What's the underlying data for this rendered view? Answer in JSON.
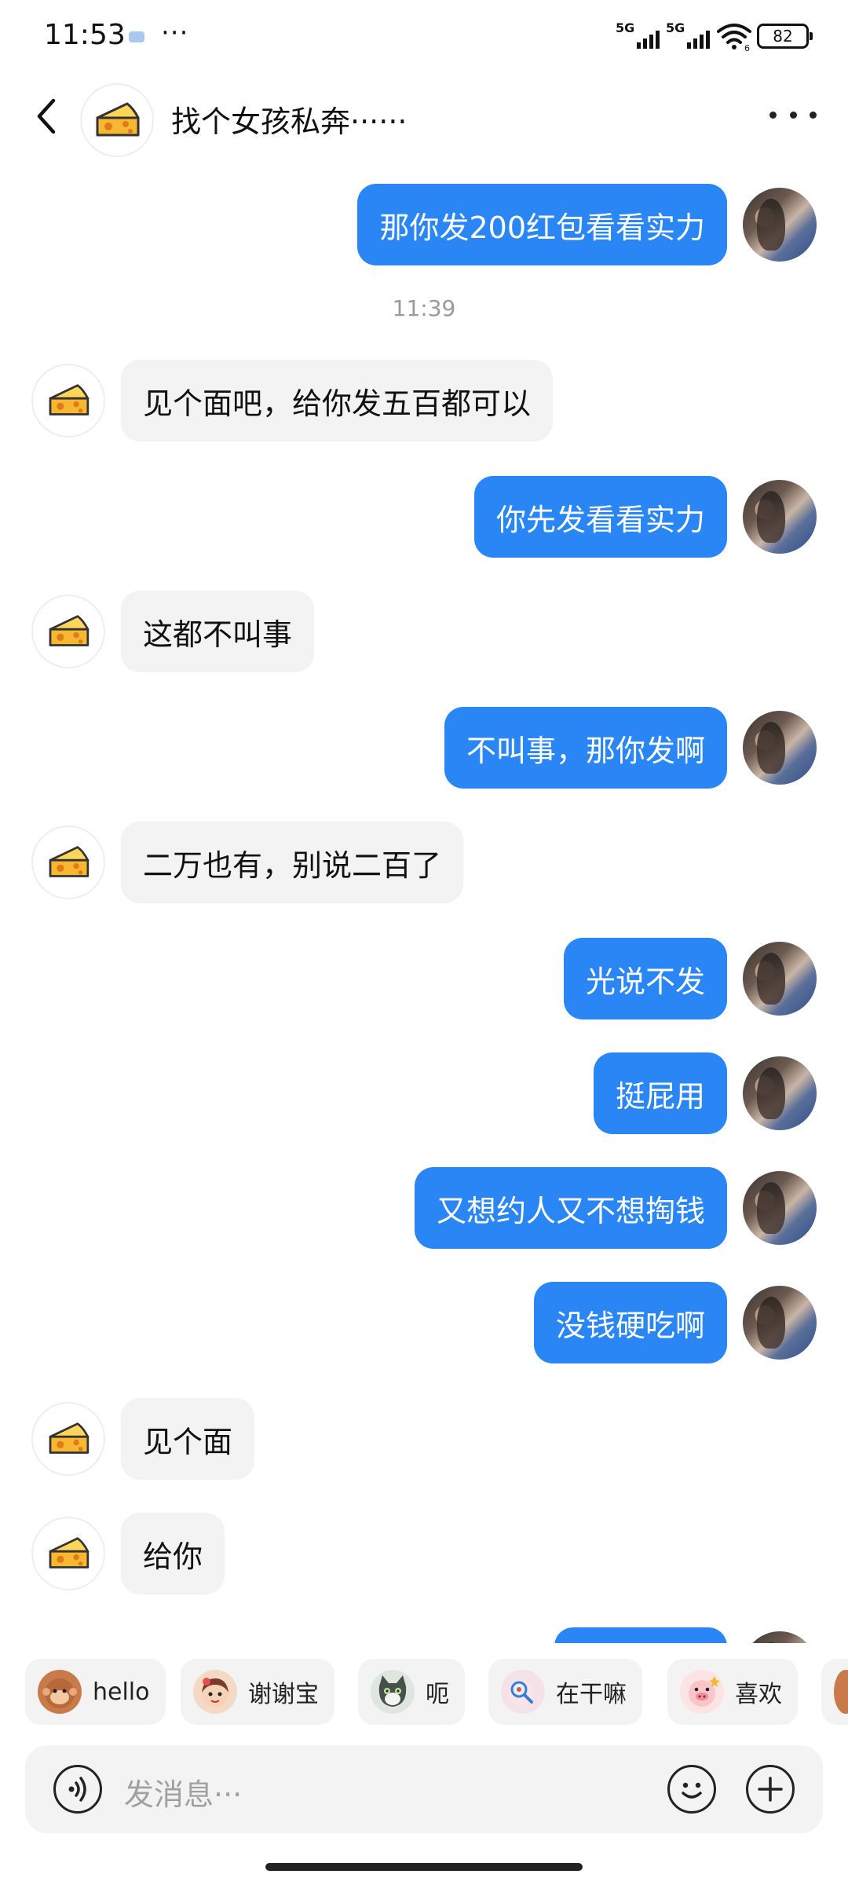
{
  "status_bar": {
    "time": "11:53",
    "more": "···",
    "signal1_label": "5G",
    "signal2_label": "5G",
    "wifi_badge": "6",
    "battery": "82"
  },
  "header": {
    "title": "找个女孩私奔······",
    "avatar_icon": "cheese-icon",
    "back_icon": "chevron-left-icon",
    "more_icon": "more-dots-icon"
  },
  "messages": [
    {
      "side": "out",
      "text": "那你发200红包看看实力"
    },
    {
      "timestamp": "11:39"
    },
    {
      "side": "in",
      "text": "见个面吧，给你发五百都可以"
    },
    {
      "side": "out",
      "text": "你先发看看实力"
    },
    {
      "side": "in",
      "text": "这都不叫事"
    },
    {
      "side": "out",
      "text": "不叫事，那你发啊"
    },
    {
      "side": "in",
      "text": "二万也有，别说二百了"
    },
    {
      "side": "out",
      "text": "光说不发"
    },
    {
      "side": "out",
      "text": "挺屁用"
    },
    {
      "side": "out",
      "text": "又想约人又不想掏钱"
    },
    {
      "side": "out",
      "text": "没钱硬吃啊"
    },
    {
      "side": "in",
      "text": "见个面"
    },
    {
      "side": "in",
      "text": "给你"
    }
  ],
  "quick_replies": [
    {
      "label": "hello",
      "icon": "monkey-sticker-icon"
    },
    {
      "label": "谢谢宝",
      "icon": "girl-sticker-icon"
    },
    {
      "label": "呃",
      "icon": "cat-sticker-icon"
    },
    {
      "label": "在干嘛",
      "icon": "magnifier-sticker-icon"
    },
    {
      "label": "喜欢",
      "icon": "pig-sticker-icon"
    }
  ],
  "input": {
    "placeholder": "发消息···",
    "voice_icon": "voice-icon",
    "emoji_icon": "smiley-icon",
    "plus_icon": "plus-icon"
  },
  "colors": {
    "outgoing_bubble": "#2a86f4",
    "incoming_bubble": "#f3f3f3",
    "cheese": "#f7b731"
  }
}
